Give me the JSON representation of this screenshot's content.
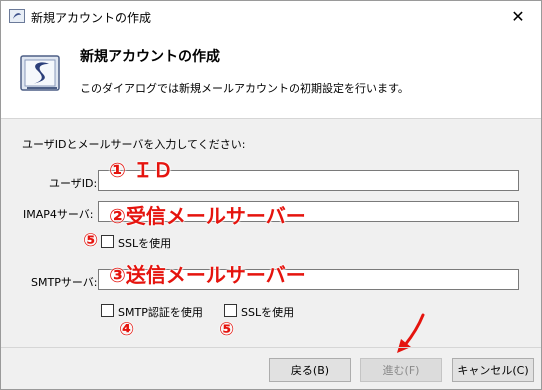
{
  "window": {
    "title": "新規アカウントの作成",
    "close_glyph": "✕"
  },
  "header": {
    "title": "新規アカウントの作成",
    "description": "このダイアログでは新規メールアカウントの初期設定を行います。"
  },
  "form": {
    "instructions": "ユーザIDとメールサーバを入力してください:",
    "user_id_label": "ユーザID:",
    "user_id_value": "",
    "imap_label": "IMAP4サーバ:",
    "imap_value": "",
    "imap_ssl_label": "SSLを使用",
    "imap_ssl_checked": false,
    "smtp_label": "SMTPサーバ:",
    "smtp_value": "",
    "smtp_auth_label": "SMTP認証を使用",
    "smtp_auth_checked": false,
    "smtp_ssl_label": "SSLを使用",
    "smtp_ssl_checked": false
  },
  "annotations": {
    "a1": "① ＩＤ",
    "a2": "②受信メールサーバー",
    "a3": "③送信メールサーバー",
    "a4": "④",
    "a5a": "⑤",
    "a5b": "⑤",
    "color": "#e5140e"
  },
  "buttons": {
    "back": "戻る(B)",
    "next": "進む(F)",
    "cancel": "キャンセル(C)",
    "next_disabled": true
  }
}
